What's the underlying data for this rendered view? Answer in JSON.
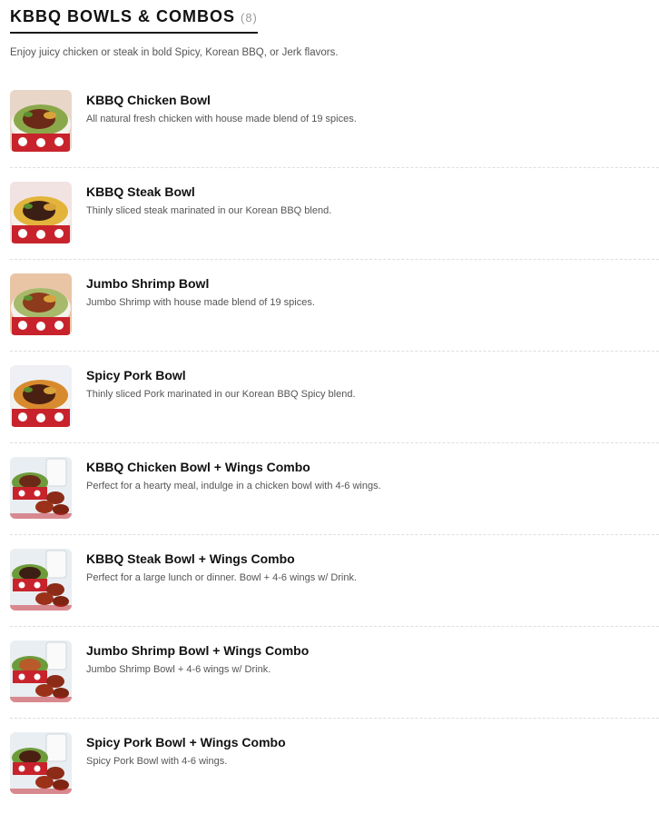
{
  "category": {
    "title": "KBBQ BOWLS & COMBOS",
    "count": "(8)",
    "description": "Enjoy juicy chicken or steak in bold Spicy, Korean BBQ, or Jerk flavors."
  },
  "items": [
    {
      "name": "KBBQ Chicken Bowl",
      "description": "All natural fresh chicken with house made blend of 19 spices.",
      "thumb": "chicken-bowl-photo"
    },
    {
      "name": "KBBQ Steak Bowl",
      "description": "Thinly sliced steak marinated in our Korean BBQ blend.",
      "thumb": "steak-bowl-photo"
    },
    {
      "name": "Jumbo Shrimp Bowl",
      "description": "Jumbo Shrimp with house made blend of 19 spices.",
      "thumb": "shrimp-bowl-photo"
    },
    {
      "name": "Spicy Pork Bowl",
      "description": "Thinly sliced Pork marinated in our Korean BBQ Spicy blend.",
      "thumb": "pork-bowl-photo"
    },
    {
      "name": "KBBQ Chicken Bowl + Wings Combo",
      "description": "Perfect for a hearty meal, indulge in a chicken bowl with 4-6 wings.",
      "thumb": "chicken-combo-photo"
    },
    {
      "name": "KBBQ Steak Bowl + Wings Combo",
      "description": "Perfect for a large lunch or dinner. Bowl + 4-6 wings w/ Drink.",
      "thumb": "steak-combo-photo"
    },
    {
      "name": "Jumbo Shrimp Bowl + Wings Combo",
      "description": "Jumbo Shrimp Bowl + 4-6 wings w/ Drink.",
      "thumb": "shrimp-combo-photo"
    },
    {
      "name": "Spicy Pork Bowl + Wings Combo",
      "description": "Spicy Pork Bowl with 4-6 wings.",
      "thumb": "pork-combo-photo"
    }
  ],
  "colors": {
    "heading": "#111111",
    "body_text": "#555555",
    "count": "#9a9a9a",
    "separator": "#dedede",
    "bowl_red": "#c8232c"
  }
}
